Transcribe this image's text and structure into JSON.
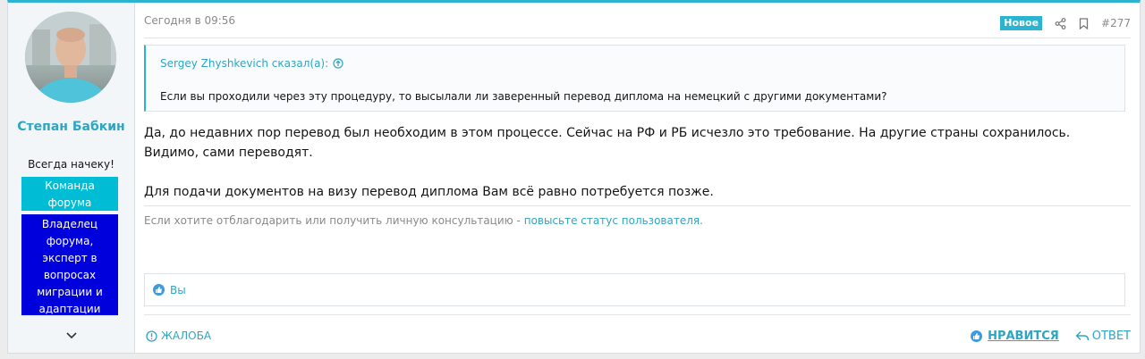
{
  "user": {
    "name": "Степан Бабкин",
    "title": "Всегда начеку!",
    "banner_team": "Команда форума",
    "banner_owner": "Владелец форума, эксперт в вопросах миграции и адаптации"
  },
  "post": {
    "date": "Сегодня в 09:56",
    "badge": "Новое",
    "number": "#277",
    "quote_author": "Sergey Zhyshkevich сказал(а):",
    "quote_text": "Если вы проходили через эту процедуру, то высылали ли заверенный перевод диплома на немецкий с другими документами?",
    "body_p1": "Да, до недавних пор перевод был необходим в этом процессе. Сейчас на РФ и РБ исчезло это требование. На другие страны сохранилось. Видимо, сами переводят.",
    "body_p2": "Для подачи документов на визу перевод диплома Вам всё равно потребуется позже.",
    "signature_text": "Если хотите отблагодарить или получить личную консультацию - ",
    "signature_link": "повысьте статус пользователя",
    "signature_end": ".",
    "reaction_user": "Вы"
  },
  "footer": {
    "report": "ЖАЛОБА",
    "like": "НРАВИТСЯ",
    "reply": "ОТВЕТ"
  },
  "colors": {
    "accent": "#2bb3cf",
    "banner_team": "#00bcd4",
    "banner_owner": "#0000dd"
  }
}
